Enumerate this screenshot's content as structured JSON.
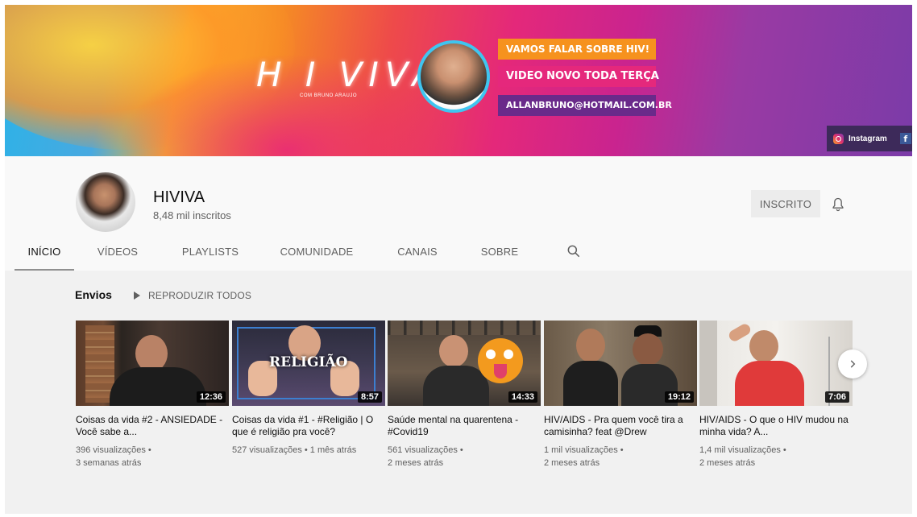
{
  "banner": {
    "title": "H I VIVA",
    "subtitle": "COM BRUNO ARAUJO",
    "badge_1": "VAMOS FALAR SOBRE HIV!",
    "badge_2": "VIDEO NOVO TODA TERÇA",
    "badge_3": "ALLANBRUNO@HOTMAIL.COM.BR",
    "social_instagram": "Instagram",
    "social_facebook": "f"
  },
  "channel": {
    "name": "HIVIVA",
    "subscribers": "8,48 mil inscritos",
    "subscribe_label": "INSCRITO"
  },
  "tabs": [
    {
      "label": "INÍCIO",
      "active": true
    },
    {
      "label": "VÍDEOS"
    },
    {
      "label": "PLAYLISTS"
    },
    {
      "label": "COMUNIDADE"
    },
    {
      "label": "CANAIS"
    },
    {
      "label": "SOBRE"
    }
  ],
  "shelf": {
    "title": "Envios",
    "play_all": "REPRODUZIR TODOS",
    "videos": [
      {
        "title": "Coisas da vida #2 - ANSIEDADE - Você sabe a...",
        "duration": "12:36",
        "views": "396 visualizações •",
        "age": "3 semanas atrás"
      },
      {
        "title": "Coisas da vida #1 - #Religião | O que é religião pra você?",
        "duration": "8:57",
        "views": "527 visualizações • 1 mês atrás",
        "age": "",
        "overlay": "RELIGIÃO"
      },
      {
        "title": "Saúde mental na quarentena - #Covid19",
        "duration": "14:33",
        "views": "561 visualizações •",
        "age": "2 meses atrás"
      },
      {
        "title": "HIV/AIDS - Pra quem você tira a camisinha? feat @Drew",
        "duration": "19:12",
        "views": "1 mil visualizações •",
        "age": "2 meses atrás"
      },
      {
        "title": "HIV/AIDS - O que o HIV mudou na minha vida? A...",
        "duration": "7:06",
        "views": "1,4 mil visualizações •",
        "age": "2 meses atrás"
      }
    ]
  },
  "colors": {
    "accent_orange": "#f6921e",
    "accent_pink": "#e5287c",
    "accent_purple": "#6a2a8a",
    "ring_blue": "#3fc5f0"
  }
}
